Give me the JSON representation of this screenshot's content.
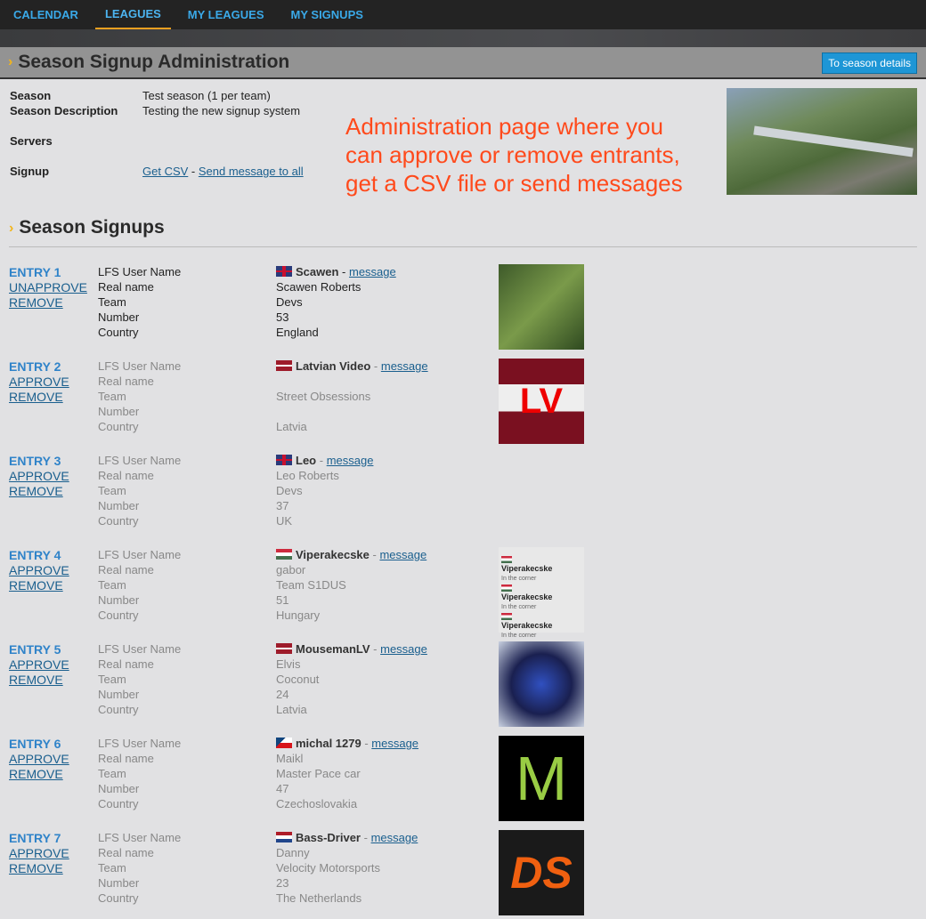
{
  "nav": [
    "CALENDAR",
    "LEAGUES",
    "MY LEAGUES",
    "MY SIGNUPS"
  ],
  "title": "Season Signup Administration",
  "season_details_button": "To season details",
  "info": {
    "season_label": "Season",
    "season_value": "Test season (1 per team)",
    "desc_label": "Season Description",
    "desc_value": "Testing the new signup system",
    "servers_label": "Servers",
    "signup_label": "Signup",
    "csv_link": "Get CSV",
    "sep": " - ",
    "msg_all_link": "Send message to all"
  },
  "promo": [
    "Administration page where you",
    "can approve or remove entrants,",
    "get a CSV file or send messages"
  ],
  "signups_title": "Season Signups",
  "field_labels": [
    "LFS User Name",
    "Real name",
    "Team",
    "Number",
    "Country"
  ],
  "message_link": "message",
  "remove_label": "REMOVE",
  "avatar4_text": [
    "Viperakecske",
    "In the corner"
  ],
  "entries": [
    {
      "title": "ENTRY 1",
      "action": "UNAPPROVE",
      "user": "Scawen",
      "flag": "uk",
      "real": "Scawen Roberts",
      "team": "Devs",
      "number": "53",
      "country": "England",
      "approved": true,
      "avatar": "a1",
      "avatar_text": ""
    },
    {
      "title": "ENTRY 2",
      "action": "APPROVE",
      "user": "Latvian Video",
      "flag": "lv",
      "real": "",
      "team": "Street Obsessions",
      "number": "",
      "country": "Latvia",
      "avatar": "a2",
      "avatar_text": "LV"
    },
    {
      "title": "ENTRY 3",
      "action": "APPROVE",
      "user": "Leo",
      "flag": "uk",
      "real": "Leo Roberts",
      "team": "Devs",
      "number": "37",
      "country": "UK",
      "avatar": "",
      "avatar_text": ""
    },
    {
      "title": "ENTRY 4",
      "action": "APPROVE",
      "user": "Viperakecske",
      "flag": "hu",
      "real": "gabor",
      "team": "Team S1DUS",
      "number": "51",
      "country": "Hungary",
      "avatar": "a4",
      "avatar_text": ""
    },
    {
      "title": "ENTRY 5",
      "action": "APPROVE",
      "user": "MousemanLV",
      "flag": "lv",
      "real": "Elvis",
      "team": "Coconut",
      "number": "24",
      "country": "Latvia",
      "avatar": "a5",
      "avatar_text": ""
    },
    {
      "title": "ENTRY 6",
      "action": "APPROVE",
      "user": "michal 1279",
      "flag": "cz",
      "real": "Maikl",
      "team": "Master Pace car",
      "number": "47",
      "country": "Czechoslovakia",
      "avatar": "a6",
      "avatar_text": "M"
    },
    {
      "title": "ENTRY 7",
      "action": "APPROVE",
      "user": "Bass-Driver",
      "flag": "nl",
      "real": "Danny",
      "team": "Velocity Motorsports",
      "number": "23",
      "country": "The Netherlands",
      "avatar": "a7",
      "avatar_text": "DS"
    }
  ]
}
